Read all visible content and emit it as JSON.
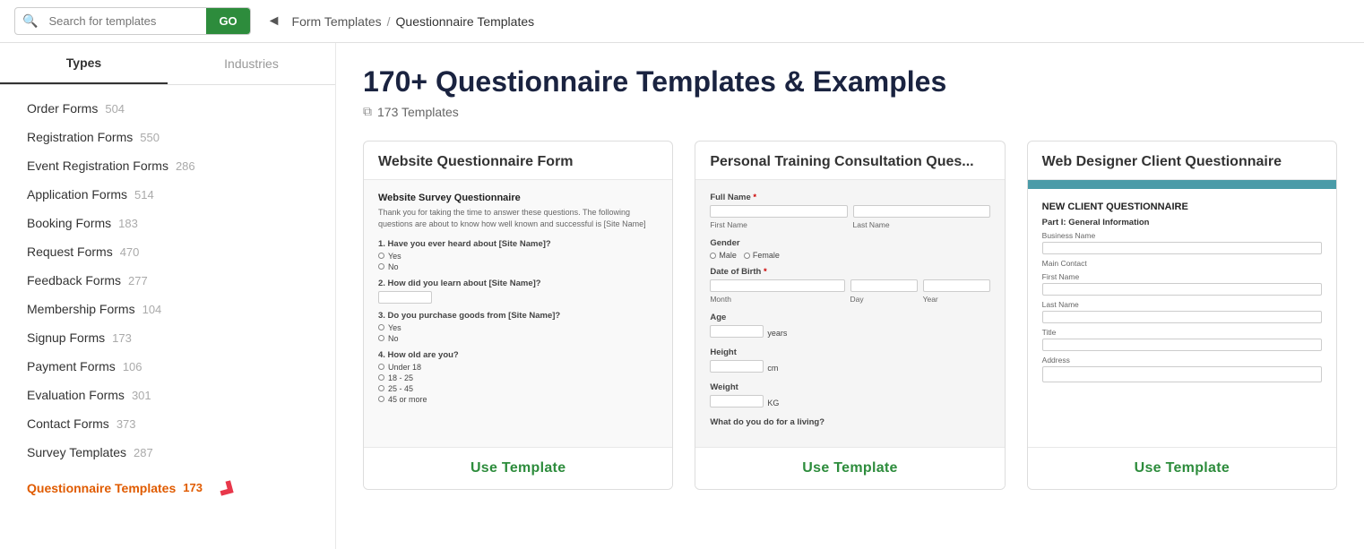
{
  "topbar": {
    "search_placeholder": "Search for templates",
    "go_label": "GO",
    "breadcrumb_back": "◄",
    "breadcrumb_link": "Form Templates",
    "breadcrumb_sep": "/",
    "breadcrumb_current": "Questionnaire Templates"
  },
  "sidebar": {
    "tab_types": "Types",
    "tab_industries": "Industries",
    "items": [
      {
        "label": "Order Forms",
        "count": "504",
        "active": false
      },
      {
        "label": "Registration Forms",
        "count": "550",
        "active": false
      },
      {
        "label": "Event Registration Forms",
        "count": "286",
        "active": false
      },
      {
        "label": "Application Forms",
        "count": "514",
        "active": false
      },
      {
        "label": "Booking Forms",
        "count": "183",
        "active": false
      },
      {
        "label": "Request Forms",
        "count": "470",
        "active": false
      },
      {
        "label": "Feedback Forms",
        "count": "277",
        "active": false
      },
      {
        "label": "Membership Forms",
        "count": "104",
        "active": false
      },
      {
        "label": "Signup Forms",
        "count": "173",
        "active": false
      },
      {
        "label": "Payment Forms",
        "count": "106",
        "active": false
      },
      {
        "label": "Evaluation Forms",
        "count": "301",
        "active": false
      },
      {
        "label": "Contact Forms",
        "count": "373",
        "active": false
      },
      {
        "label": "Survey Templates",
        "count": "287",
        "active": false
      },
      {
        "label": "Questionnaire Templates",
        "count": "173",
        "active": true
      }
    ]
  },
  "content": {
    "page_title": "170+ Questionnaire Templates & Examples",
    "template_count_icon": "⧉",
    "template_count": "173 Templates"
  },
  "cards": [
    {
      "title": "Website Questionnaire Form",
      "preview_title": "Website Survey Questionnaire",
      "preview_subtitle": "Thank you for taking the time to answer these questions. The following questions are about to know how well known and successful is [Site Name]",
      "questions": [
        {
          "text": "1. Have you ever heard about [Site Name]?",
          "type": "radio",
          "options": [
            "Yes",
            "No"
          ]
        },
        {
          "text": "2. How did you learn about [Site Name]?",
          "type": "select"
        },
        {
          "text": "3. Do you purchase goods from [Site Name]?",
          "type": "radio",
          "options": [
            "Yes",
            "No"
          ]
        },
        {
          "text": "4. How old are you?",
          "type": "radio",
          "options": [
            "Under 18",
            "18 - 25",
            "25 - 45",
            "45 or more"
          ]
        }
      ],
      "btn_label": "Use Template"
    },
    {
      "title": "Personal Training Consultation Ques...",
      "preview_fields": [
        {
          "label": "Full Name",
          "required": true,
          "type": "name_row",
          "subfields": [
            "First Name",
            "Last Name"
          ]
        },
        {
          "label": "Gender",
          "type": "radio_inline",
          "options": [
            "Male",
            "Female"
          ]
        },
        {
          "label": "Date of Birth",
          "required": true,
          "type": "date_row",
          "subfields": [
            "Month",
            "Day",
            "Year"
          ]
        },
        {
          "label": "Age",
          "type": "text_unit",
          "unit": "years"
        },
        {
          "label": "Height",
          "type": "text_unit",
          "unit": "cm"
        },
        {
          "label": "Weight",
          "type": "text_unit",
          "unit": "KG"
        },
        {
          "label": "What do you do for a living?",
          "type": "text"
        }
      ],
      "btn_label": "Use Template"
    },
    {
      "title": "Web Designer Client Questionnaire",
      "header_color": "#4a9ba8",
      "preview_heading": "NEW CLIENT QUESTIONNAIRE",
      "section_title": "Part I: General Information",
      "fields": [
        {
          "label": "Business Name"
        },
        {
          "label": "Main Contact"
        },
        {
          "label": "First Name"
        },
        {
          "label": "Last Name"
        },
        {
          "label": "Title"
        },
        {
          "label": "Address"
        }
      ],
      "btn_label": "Use Template"
    }
  ]
}
